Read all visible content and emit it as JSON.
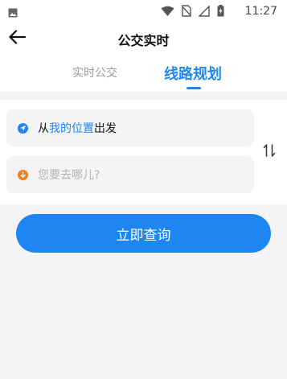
{
  "status_bar": {
    "time": "11:27",
    "icons": [
      "gallery-icon",
      "wifi-icon",
      "no-sim-icon",
      "signal-icon",
      "battery-charging-icon"
    ]
  },
  "header": {
    "title": "公交实时",
    "back_icon": "arrow-left-icon"
  },
  "tabs": [
    {
      "label": "实时公交",
      "active": false
    },
    {
      "label": "线路规划",
      "active": true
    }
  ],
  "route": {
    "from_prefix": "从",
    "from_highlight": "我的位置",
    "from_suffix": "出发",
    "to_placeholder": "您要去哪儿?",
    "swap_icon": "swap-vertical-icon"
  },
  "query_button": {
    "label": "立即查询"
  },
  "colors": {
    "accent": "#1d86f2",
    "destination": "#f57c1f",
    "background": "#f4f4f6"
  }
}
